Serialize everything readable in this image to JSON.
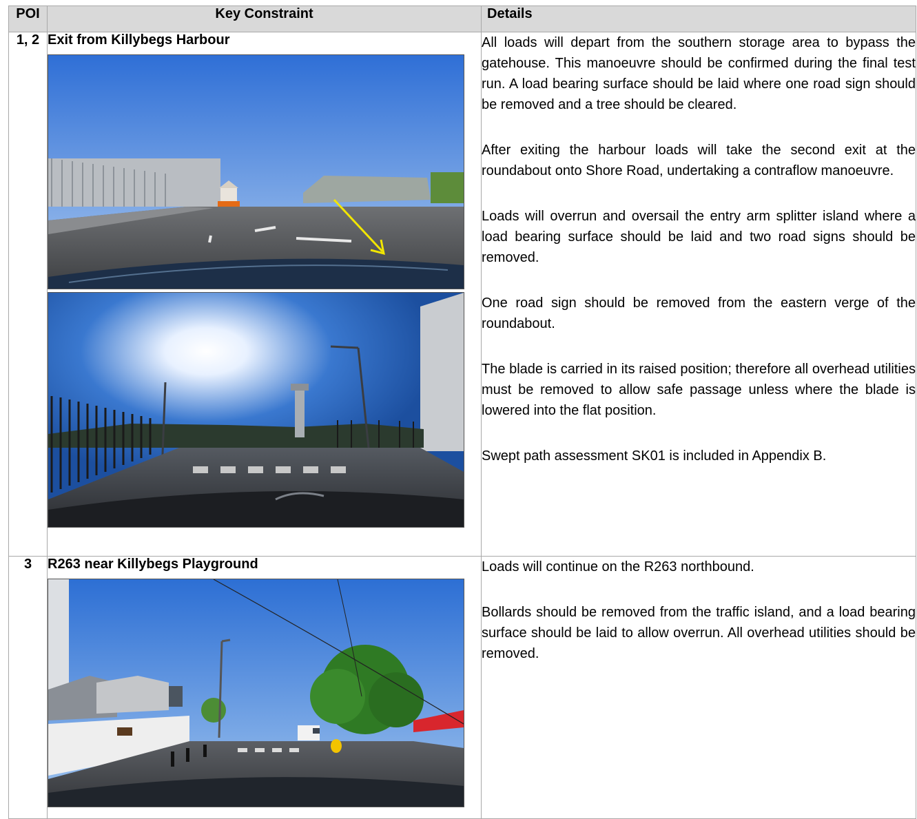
{
  "table": {
    "headers": {
      "poi": "POI",
      "constraint": "Key Constraint",
      "details": "Details"
    },
    "rows": [
      {
        "poi": "1, 2",
        "constraint": "Exit from Killybegs Harbour",
        "details": [
          "All loads will depart from the southern storage area to bypass the gatehouse. This manoeuvre should be confirmed during the final test run. A load bearing surface should be laid where one road sign should be removed and a tree should be cleared.",
          "After exiting the harbour loads will take the second exit at the roundabout onto Shore Road, undertaking a contraflow manoeuvre.",
          "Loads will overrun and oversail the entry arm splitter island where a load bearing surface should be laid and two road signs should be removed.",
          "One road sign should be removed from the eastern verge of the roundabout.",
          "The blade is carried in its raised position; therefore all overhead utilities must be removed to allow safe passage unless where the blade is lowered into the flat position.",
          "Swept path assessment SK01 is included in Appendix B."
        ]
      },
      {
        "poi": "3",
        "constraint": "R263 near Killybegs Playground",
        "details": [
          "Loads will continue on the R263 northbound.",
          "Bollards should be removed from the traffic island, and a load bearing surface should be laid to allow overrun. All overhead utilities should be removed."
        ]
      }
    ]
  },
  "colors": {
    "header_bg": "#d9d9d9",
    "border": "#a8a8a8",
    "arrow": "#f2e600"
  }
}
